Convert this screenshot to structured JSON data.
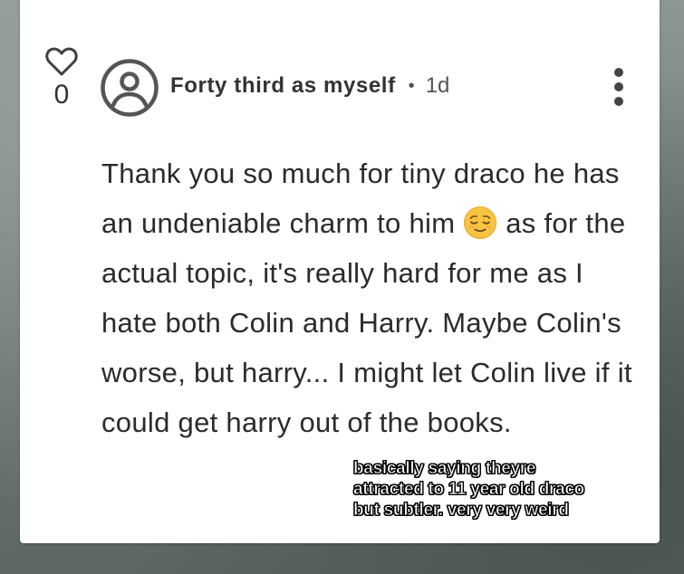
{
  "comment": {
    "likes": "0",
    "author": "Forty third as myself",
    "separator": "•",
    "time": "1d",
    "text_parts": {
      "before_emoji": "Thank you so much for tiny draco he has an undeniable charm to him ",
      "after_emoji": " as for the actual topic, it's really hard for me as I hate both Colin and Harry. Maybe Colin's worse, but harry... I might let Colin live if it could get harry out of the books."
    },
    "icons": {
      "like": "heart-icon",
      "avatar": "user-avatar-icon",
      "emoji": "relieved-face-emoji",
      "menu": "more-vertical-icon"
    }
  },
  "overlay_caption": {
    "lines": [
      "basically saying theyre",
      "attracted to 11 year old draco",
      "but subtler. very very weird"
    ]
  },
  "colors": {
    "card": "#ffffff",
    "text": "#2b2b2b",
    "icon": "#444444",
    "emoji": "#f7c341"
  }
}
